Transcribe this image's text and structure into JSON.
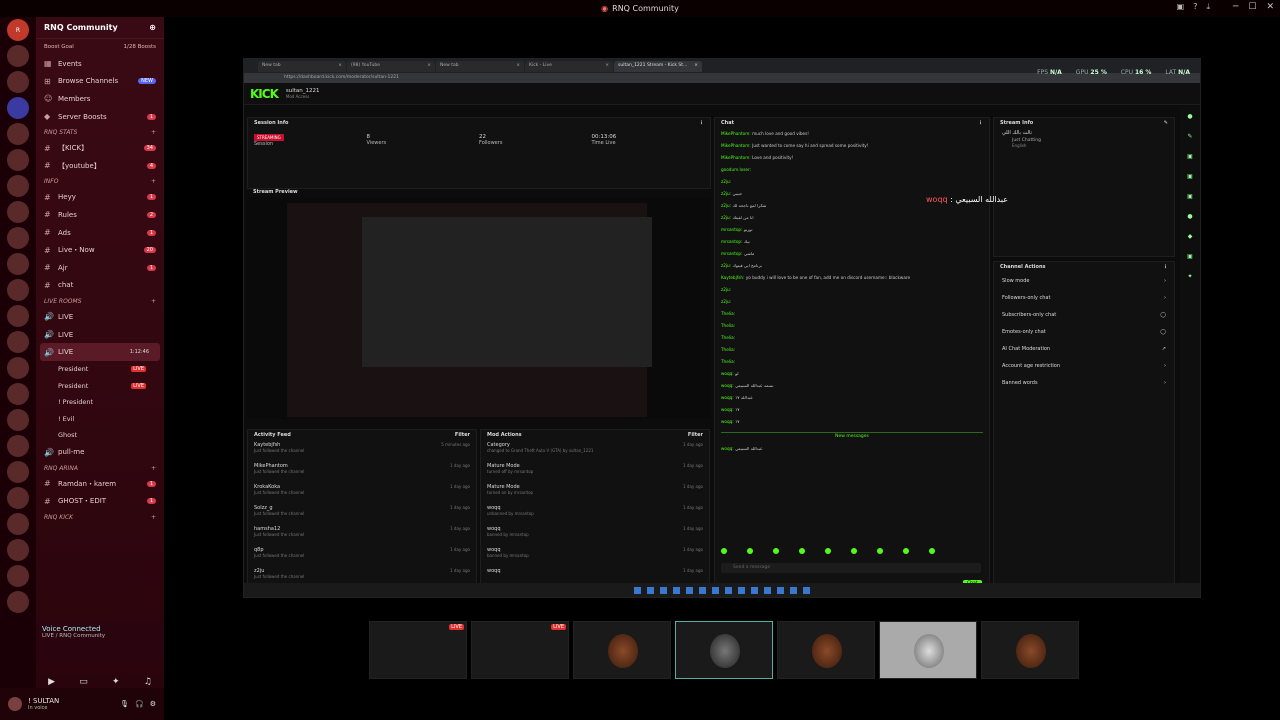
{
  "window": {
    "title": "RNQ Community"
  },
  "server": {
    "name": "RNQ Community",
    "boost_goal": "Boost Goal",
    "boosts": "1/28 Boosts"
  },
  "nav": [
    {
      "label": "Events"
    },
    {
      "label": "Browse Channels",
      "badge": "NEW"
    },
    {
      "label": "Members"
    },
    {
      "label": "Server Boosts",
      "badge": "1"
    }
  ],
  "categories": {
    "stats": "RNQ STATS",
    "info": "INFO",
    "live_rooms": "LIVE ROOMS",
    "arina": "RNQ ARINA",
    "kick": "RNQ KICK"
  },
  "stats_channels": [
    {
      "label": "【KICK】",
      "badge": "34"
    },
    {
      "label": "【youtube】",
      "badge": "4"
    }
  ],
  "info_channels": [
    {
      "label": "Heyy",
      "badge": "1"
    },
    {
      "label": "Rules",
      "badge": "2"
    },
    {
      "label": "Ads",
      "badge": "1"
    },
    {
      "label": "Live・Now",
      "badge": "20"
    },
    {
      "label": "Ajr",
      "badge": "1"
    }
  ],
  "misc_channel": "chat",
  "live_rooms": [
    {
      "label": "LIVE"
    },
    {
      "label": "LIVE"
    },
    {
      "label": "LIVE",
      "time": "1:12:46"
    }
  ],
  "live_users": [
    {
      "name": "President",
      "tag": "LIVE"
    },
    {
      "name": "President",
      "tag": "LIVE"
    },
    {
      "name": "! President"
    },
    {
      "name": "! Evil"
    },
    {
      "name": "Ghost"
    }
  ],
  "pull_me": "pull-me",
  "arina_channels": [
    {
      "label": "Ramdan・karem",
      "badge": "1"
    },
    {
      "label": "GHOST・EDIT",
      "badge": "1"
    }
  ],
  "voice": {
    "status": "Voice Connected",
    "channel": "LIVE / RNQ Community"
  },
  "user": {
    "name": "! SULTAN",
    "status": "In voice"
  },
  "browser": {
    "tabs": [
      "New tab",
      "(98) YouTube",
      "New tab",
      "Kick - Live",
      "sultan_1221 Stream - Kick St..."
    ],
    "url": "https://dashboard.kick.com/moderator/sultan-1221"
  },
  "perf": {
    "fps_label": "FPS",
    "fps": "N/A",
    "gpu_label": "GPU",
    "gpu": "25 %",
    "cpu_label": "CPU",
    "cpu": "16 %",
    "lat_label": "LAT",
    "lat": "N/A"
  },
  "kick": {
    "logo": "KICK",
    "channel": "sultan_1221",
    "role": "Mod Access"
  },
  "session": {
    "title": "Session Info",
    "status": "STREAMING",
    "status_label": "Session",
    "viewers": "8",
    "viewers_label": "Viewers",
    "followers": "22",
    "followers_label": "Followers",
    "time": "00:13:06",
    "time_label": "Time Live"
  },
  "preview_title": "Stream Preview",
  "activity": {
    "title": "Activity Feed",
    "filter": "Filter",
    "rows": [
      {
        "name": "Kaytebjfsh",
        "sub": "Just followed the channel",
        "time": "5 minutes ago"
      },
      {
        "name": "MikePhantom",
        "sub": "Just followed the channel",
        "time": "1 day ago"
      },
      {
        "name": "KrokaKoka",
        "sub": "Just followed the channel",
        "time": "1 day ago"
      },
      {
        "name": "Solzz_g",
        "sub": "Just followed the channel",
        "time": "1 day ago"
      },
      {
        "name": "hamsha12",
        "sub": "Just followed the channel",
        "time": "1 day ago"
      },
      {
        "name": "q8p",
        "sub": "Just followed the channel",
        "time": "1 day ago"
      },
      {
        "name": "z2ju",
        "sub": "Just followed the channel",
        "time": "1 day ago"
      }
    ]
  },
  "modactions": {
    "title": "Mod Actions",
    "filter": "Filter",
    "rows": [
      {
        "name": "Category",
        "sub": "changed to Grand Theft Auto V (GTA) by sultan_1221",
        "time": "1 day ago"
      },
      {
        "name": "Mature Mode",
        "sub": "turned off by mrsantop",
        "time": "1 day ago"
      },
      {
        "name": "Mature Mode",
        "sub": "turned on by mrsantop",
        "time": "1 day ago"
      },
      {
        "name": "woqq",
        "sub": "unbanned by mrsantop",
        "time": "1 day ago"
      },
      {
        "name": "woqq",
        "sub": "banned by mrsantop",
        "time": "1 day ago"
      },
      {
        "name": "woqq",
        "sub": "banned by mrsantop",
        "time": "1 day ago"
      },
      {
        "name": "woqq",
        "sub": "",
        "time": "1 day ago"
      }
    ]
  },
  "chat": {
    "title": "Chat",
    "new_messages": "New messages",
    "placeholder": "Send a message",
    "send": "Chat",
    "messages": [
      {
        "user": "MikePhantom:",
        "text": "much love and good vibes!"
      },
      {
        "user": "MikePhantom:",
        "text": "Just wanted to come say hi and spread some positivity!"
      },
      {
        "user": "MikePhantom:",
        "text": "Love and positivity!"
      },
      {
        "user": "goodum.loser:",
        "text": ""
      },
      {
        "user": "z2ju:",
        "text": ""
      },
      {
        "user": "z2ju:",
        "text": "حبيبي"
      },
      {
        "user": "z2ju:",
        "text": "شكرا لمع ناجحة لك"
      },
      {
        "user": "z2ju:",
        "text": "انا من لقيتك"
      },
      {
        "user": "mrsantop:",
        "text": "نورتو"
      },
      {
        "user": "mrsantop:",
        "text": "نيك"
      },
      {
        "user": "mrsantop:",
        "text": "ماشي"
      },
      {
        "user": "z2ju:",
        "text": "برنامج ابي فيتوك"
      },
      {
        "user": "Kaytebjfsh:",
        "text": "yo buddy i will love to be one of fan, add me on discord username:: blackware"
      },
      {
        "user": "z2ju:",
        "text": ""
      },
      {
        "user": "z2ju:",
        "text": ""
      },
      {
        "user": "Thelia:",
        "text": ""
      },
      {
        "user": "Thelia:",
        "text": ""
      },
      {
        "user": "Thelia:",
        "text": ""
      },
      {
        "user": "Thelia:",
        "text": ""
      },
      {
        "user": "Thelia:",
        "text": ""
      },
      {
        "user": "woqq:",
        "text": "لو"
      },
      {
        "user": "woqq:",
        "text": "نسمه عبدالله السبيعي"
      },
      {
        "user": "woqq:",
        "text": "عبدالله ١٧"
      },
      {
        "user": "woqq:",
        "text": "١٧"
      },
      {
        "user": "woqq:",
        "text": "١٧"
      }
    ],
    "last": {
      "user": "woqq:",
      "text": "عبدالله السبيعي"
    }
  },
  "streaminfo": {
    "title": "Stream Info",
    "name": "ثالث بالك اللي",
    "category": "Just Chatting",
    "lang": "English"
  },
  "channel_actions": {
    "title": "Channel Actions",
    "items": [
      "Slow mode",
      "Followers-only chat",
      "Subscribers-only chat",
      "Emotes-only chat",
      "AI Chat Moderation",
      "Account age restriction",
      "Banned words"
    ]
  },
  "annotation": {
    "user": "woqq",
    "text": "عبدالله السبيعي"
  },
  "tiles": [
    {
      "tag": "LIVE"
    },
    {
      "tag": "LIVE"
    },
    {},
    {},
    {},
    {},
    {}
  ]
}
